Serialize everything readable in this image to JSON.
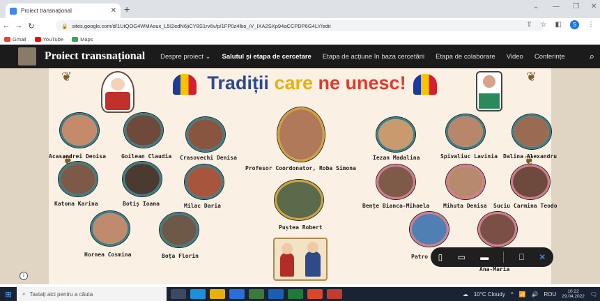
{
  "browser": {
    "tab_title": "Proiect transnațional",
    "url": "sites.google.com/d/1UtQOG4WMAsux_L5I2edN6jiCY8S1rv6v/p/1FP0z4lbo_iV_IXA2SXp94aCCPDP6G4LY/edit",
    "bookmarks": [
      "Gmail",
      "YouTube",
      "Maps"
    ]
  },
  "site": {
    "title": "Proiect transnațional",
    "nav": [
      "Despre proiect ⌄",
      "Salutul și etapa de cercetare",
      "Etapa de acțiune în baza cercetării",
      "Etapa de colaborare",
      "Video",
      "Conferințe"
    ]
  },
  "banner": {
    "heading_1": "Tradiții",
    "heading_2": "care",
    "heading_3": "ne unesc!",
    "names": {
      "acasandrei": "Acasandrei Denisa",
      "goilean": "Goilean Claudia",
      "crasovschi": "Crasovechi Denisa",
      "coordinator": "Profesor Coordonator, Roba Simona",
      "iezan": "Iezan Madalina",
      "spivaliuc": "Spivaliuc Lavinia",
      "dalina": "Dalina Alexandru",
      "katona": "Katona Karina",
      "botis": "Botiș Ioana",
      "milac": "Milac Daria",
      "pustea": "Puștea Robert",
      "bense": "Bențe Bianca-Mihaela",
      "mihuta": "Mihuta Denisa",
      "suciu": "Suciu Carmina Teodo",
      "hornea": "Hornea Cosmina",
      "bota": "Boța Florin",
      "patro": "Patro",
      "ana": "Ana-Maria"
    }
  },
  "taskbar": {
    "search_placeholder": "Tastați aici pentru a căuta",
    "weather": "10°C  Cloudy",
    "lang": "ROU",
    "time": "10:22",
    "date": "29.04.2022"
  },
  "colors": {
    "accent": "#2c4a8f",
    "nav_bg": "#1b1b1b",
    "banner_bg": "#fbf0e4"
  }
}
